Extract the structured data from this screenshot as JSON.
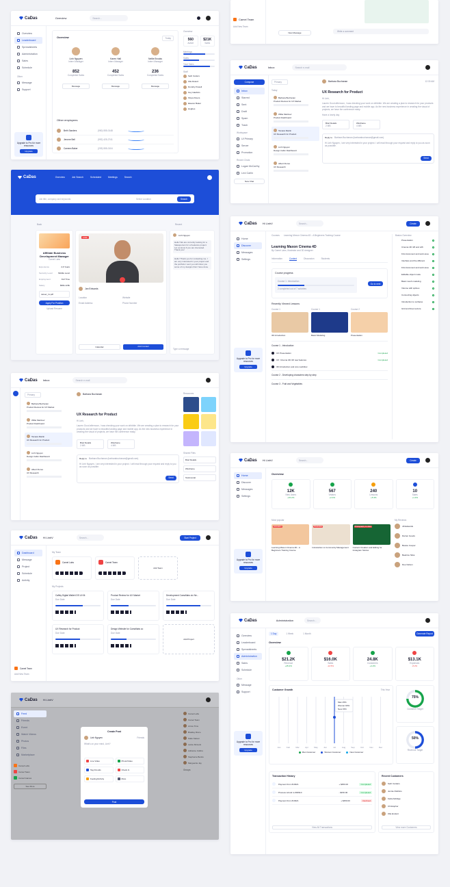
{
  "brand": {
    "name": "CaDas",
    "accent": "#1d4ed8",
    "background": "#f1f2f6"
  },
  "dashboard": {
    "page_title": "Overview",
    "search_placeholder": "Search...",
    "nav": [
      "Overview",
      "Leaderboard",
      "Spreadsheets",
      "Administration",
      "Sales",
      "Schedule"
    ],
    "other_label": "Other",
    "other_nav": [
      "Message",
      "Support"
    ],
    "overview_title": "Overview",
    "filter": "Today",
    "people": [
      {
        "name": "Linh Nguyen",
        "role": "Intern Manager",
        "value": "852",
        "stat": "Completed Sales",
        "btn": "Message"
      },
      {
        "name": "Karen Hall",
        "role": "Intern Manager",
        "value": "452",
        "stat": "Completed Sales",
        "btn": "Message"
      },
      {
        "name": "Nellie Brooks",
        "role": "Intern Manager",
        "value": "236",
        "stat": "Completed Sales",
        "btn": "Message"
      }
    ],
    "other_employees": "Other employees",
    "employees": [
      {
        "name": "Beth Sanders",
        "phone": "(950) 555-0148"
      },
      {
        "name": "Jerome Bell",
        "phone": "(992) 425-2741"
      },
      {
        "name": "Camera Baker",
        "phone": "(209) 555-0104"
      }
    ],
    "right_title": "Overview",
    "kpi": [
      {
        "value": "560",
        "label": "Active"
      },
      {
        "value": "$21K",
        "label": "Sales"
      }
    ],
    "right_bars": [
      "Meetings",
      "Sales",
      "Total Sales"
    ],
    "staff_title": "Staff",
    "staff": [
      "Seth Carters",
      "Olle Rolerd",
      "Dorothy Powell",
      "Guy Hawkins",
      "Shyra Peters",
      "Eleanor Baker",
      "Hughes"
    ],
    "upgrade": {
      "title": "Upgrade to Pro for more resources",
      "button": "Upgrade"
    }
  },
  "jobs": {
    "nav": [
      "Overview",
      "Job Search",
      "Scheduled",
      "Meetings",
      "Search"
    ],
    "search_placeholder": "Job title, company and keywords",
    "location_placeholder": "Select Location",
    "search_button": "Search",
    "back": "Back",
    "sort": "Recent",
    "job_title": "Affiliate Business Development Manager",
    "company": "Camel Labs",
    "details": [
      [
        "Experience",
        "2-6 Years"
      ],
      [
        "Seniority Level",
        "Middle Level"
      ],
      [
        "Employment",
        "Full Time"
      ],
      [
        "Salary",
        "$90k-120k"
      ]
    ],
    "file": "career_cv.pdf",
    "apply": "Apply For Position",
    "upload": "Upload Resume",
    "candidate": "Jan Edwards",
    "live": "LIVE",
    "info_labels": [
      "Location",
      "Website",
      "Email Address",
      "Phone Number"
    ],
    "chat_user": "Linh Nguyen",
    "chat_messages": [
      "Hello! We are currently looking for a Salesperson for a freelance project. Let us know if you are interested. Thank you!",
      "Hello! Thank you for contacting me. I am very interested in your project and the portfolio I sent you will show you some of my designs that I have done."
    ],
    "calendar": "Calendar",
    "add_contact": "Add Contact",
    "type_message": "Type a message"
  },
  "inbox_top": {
    "team": "Camel Team",
    "new_message": "New Message",
    "add_team": "Add New Team",
    "write_comment": "Write a comment"
  },
  "inbox": {
    "title": "Inbox",
    "search_placeholder": "Search e-mail",
    "compose": "Compose",
    "folders": [
      "Inbox",
      "Starred",
      "Sent",
      "Draft",
      "Spam",
      "Trash"
    ],
    "labels_title": "Workspace",
    "labels": [
      "UI Primary",
      "Server",
      "Promotion"
    ],
    "recent_chats": "Recent Chats",
    "chats": [
      "Logan McCarthy",
      "Lexi Carlin"
    ],
    "new_chat": "New Chat",
    "filter": "Primary",
    "today": "Today",
    "messages": [
      {
        "from": "Barbara Buchanan",
        "subject": "Product Review for UX Market"
      },
      {
        "from": "Willie Martinez",
        "subject": "Product Dashboard"
      },
      {
        "from": "Tamara Martin",
        "subject": "UX Research for Product"
      },
      {
        "from": "Linh Nguyen",
        "subject": "Design Cabin Dashboard"
      },
      {
        "from": "Albert Flores",
        "subject": "UX Research"
      }
    ],
    "sender": "Barbara Buchanan",
    "time": "12:30 AM",
    "subject": "UX Research for Product",
    "greeting": "Hi Linh,",
    "body": "Lauren Good afternoon, I was checking your work on dribbble. We are creating a plan to research for your products and we have to beautiful landing page and mobile app. As the new business experience in creating the visual of projects, we have the conference ready.",
    "signoff": "Have a lovely day",
    "attachments": [
      {
        "name": "Brief Details",
        "size": "2 MB"
      },
      {
        "name": "Wireframe",
        "size": "4 MB"
      }
    ],
    "reply_to": "Reply to",
    "reply_email": "Barbara Buchanan (barbarabuchanan@gmail.com)",
    "reply_text": "Hi Linh Nguyen, I am very interested in your project. I will read through your request and reply to you as soon as possible.",
    "send": "Send",
    "resources": "Resources",
    "shared_files": "Shared Files",
    "files": [
      "Brief Details",
      "Wireframe",
      "Testimonial"
    ]
  },
  "course": {
    "greeting": "Hi LinhV",
    "search_placeholder": "Search...",
    "create": "Create",
    "nav": [
      "Home",
      "Discover",
      "Messages",
      "Settings"
    ],
    "breadcrumb": [
      "Courses",
      "Learning Mexon Cinema 4D - A Beginners Training Course"
    ],
    "title": "Learning Maxon Cinema 4D",
    "subtitle": "By Camel Labs, Illustrator and 3D designer",
    "tabs": [
      "Information",
      "Content",
      "Discussion",
      "Students"
    ],
    "progress_title": "Course progress",
    "progress_item": "Course 1: Introduction",
    "progress_value": 0.35,
    "progress_label": "2 completed out of 7 activities",
    "go_btn": "Go to next",
    "recent_title": "Recently Viewed Lessons",
    "lessons": [
      {
        "tag": "Course 1",
        "name": "3D Introduction"
      },
      {
        "tag": "Course 1",
        "name": "Basic Modeling"
      },
      {
        "tag": "Course 2",
        "name": "Presentation"
      }
    ],
    "sections": [
      "Course 1 - Introduction",
      "Course 2 - Developing characters step by step",
      "Course 3 - Fruit and Vegetables"
    ],
    "items": [
      "UX Presentation",
      "UX: Cinema 4D r26 new features",
      "3D Introduction and core workflow"
    ],
    "status": "Completed",
    "right_title": "Basics Overview",
    "right_items": [
      "Presentation",
      "Cinema 4D r26 and s26",
      "First document and work area",
      "Interface and the different",
      "First document and work area",
      "Editable object mode",
      "Basic mesh modeling",
      "Volume with splines",
      "Connecting objects",
      "Introduction to surfaces",
      "Grid and lines texture"
    ]
  },
  "course_home": {
    "overview": "Overview",
    "stats": [
      {
        "value": "12K",
        "label": "New Users",
        "delta": "+15.2%"
      },
      {
        "value": "567",
        "label": "Visitors",
        "delta": "+2.4%"
      },
      {
        "value": "240",
        "label": "Lessons",
        "delta": "+5.3%"
      },
      {
        "value": "10",
        "label": "Sales",
        "delta": "+1.4%"
      }
    ],
    "popular": "Most popular",
    "reviews": "My Reviews",
    "cards": [
      "Learning Maxon Cinema 4D - A Beginners Training Course",
      "Introduction to Community Management",
      "Content Creation and Editing for Instagram Stories"
    ],
    "tags": [
      "Animation",
      "Illustration",
      "Photography & video"
    ],
    "reviewers": [
      "Jill Edwards",
      "Darren Goods",
      "Bessie Cooper",
      "Beatrice Silva",
      "Dee Nelson"
    ]
  },
  "projects": {
    "nav": [
      "Dashboard",
      "Message",
      "Project",
      "Schedule",
      "Activity"
    ],
    "start": "Start Project",
    "my_team": "My Team",
    "teams": [
      "Camel Labs",
      "Camel Team"
    ],
    "add_team": "Add Team",
    "my_projects": "My Projects",
    "list": [
      {
        "name": "Caffey Digital Wallet iOS UI Kit",
        "due": "Due Date"
      },
      {
        "name": "Product Review for UX Market",
        "due": "Due Date"
      },
      {
        "name": "Development Camoflabs cic Ne...",
        "due": "Due Date"
      },
      {
        "name": "UX Research for Product",
        "due": "Due Date"
      },
      {
        "name": "Design Website for Camoflabs co",
        "due": "Due Date"
      }
    ],
    "add_project": "Add Project"
  },
  "social": {
    "greeting": "Hi LinhV",
    "modal_title": "Create Post",
    "user": "Linh Nguyen",
    "audience": "Friends",
    "prompt": "What's on your mind, Linh?",
    "actions": [
      "Live Video",
      "Photo/Video",
      "Tag Friends",
      "Check In",
      "Feeling/Activity",
      "More"
    ],
    "post": "Post",
    "left_nav": [
      "Feed",
      "Friends",
      "Event",
      "Watch Videos",
      "Photos",
      "Files",
      "Marketplace"
    ],
    "pages": [
      "Camel Labs",
      "Camel Team",
      "Camel Games"
    ],
    "see_more": "See More",
    "contacts": [
      "Camel Labs",
      "Camel Team",
      "Arrow Tims",
      "Bradley Ricco",
      "Katie Nelson",
      "Lainie McLuck",
      "Adrianne Collins",
      "Stephenie Benito",
      "Marguerite Jay"
    ],
    "groups": "Groups"
  },
  "admin": {
    "title": "Administration",
    "report": "Generate Report",
    "tabs": [
      "1 Day",
      "1 Week",
      "1 Month"
    ],
    "overview": "Overview",
    "stats": [
      {
        "value": "$21.2K",
        "label": "Revenue",
        "delta": "+45.2%"
      },
      {
        "value": "$16.0K",
        "label": "Sales",
        "delta": "-12.5%"
      },
      {
        "value": "24.8K",
        "label": "Customers",
        "delta": "+4.2%"
      },
      {
        "value": "$13.1K",
        "label": "Expenses",
        "delta": "-8.2%"
      }
    ],
    "growth": "Customer Growth",
    "period": "This Year",
    "legend": [
      "Man Customer",
      "Woman Customer",
      "New Customer"
    ],
    "tooltip": [
      "Man 25%",
      "Woman 60%",
      "New 15%"
    ],
    "months": [
      "Jan",
      "Feb",
      "Mar",
      "Apr",
      "May",
      "Jun",
      "Jul",
      "Aug",
      "Sep",
      "Oct",
      "Nov",
      "Dec"
    ],
    "donuts": [
      {
        "value": "75%",
        "label": "Customer Target"
      },
      {
        "value": "50%",
        "label": "Revenue Target"
      }
    ],
    "transactions": "Transaction History",
    "tx": [
      {
        "name": "Payment from #10321",
        "amount": "+ $450.00",
        "status": "Completed"
      },
      {
        "name": "Process refund to #00910",
        "amount": "- $150.00",
        "status": "Completed"
      },
      {
        "name": "Payment from #10321",
        "amount": "+ $450.00",
        "status": "Declined"
      }
    ],
    "view_all": "View All Transactions",
    "recent": "Recent Customers",
    "customers": [
      "Seth Carders",
      "Jennie Robbins",
      "Karla Aldridge",
      "Christopher",
      "Olle Emdert"
    ],
    "view_customers": "View more Customers"
  }
}
